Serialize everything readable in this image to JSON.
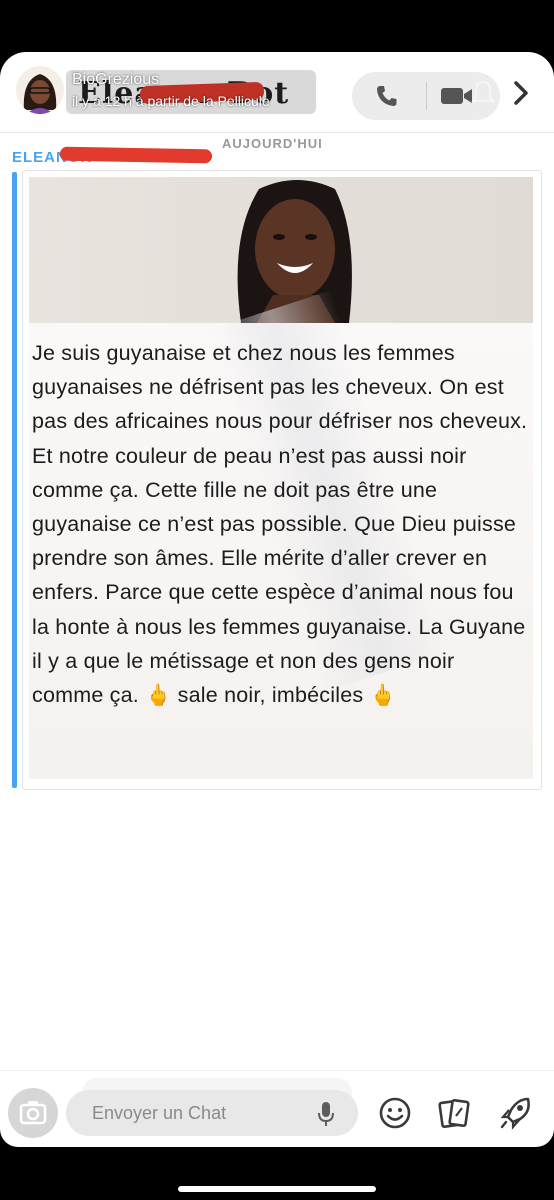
{
  "header": {
    "title": "Eleanor Bot",
    "story_name": "BioGrezious",
    "story_time": "il y a 12 h à partir de la Pellicule",
    "phone_icon": "phone-icon",
    "video_icon": "video-camera-icon",
    "chevron_icon": "chevron-right-icon"
  },
  "conversation": {
    "day_label": "AUJOURD'HUI",
    "sender": "ELEANOR",
    "accent_color": "#4aa3f0",
    "redaction_color": "#e23a2c"
  },
  "message": {
    "text": "Je suis guyanaise et chez nous les femmes guyanaises ne défrisent pas les cheveux. On est pas des africaines nous pour défriser nos cheveux. Et notre couleur de peau n’est pas aussi noir comme ça. Cette fille ne doit pas être une guyanaise ce n’est pas possible. Que Dieu puisse prendre son âmes. Elle mérite d’aller crever en enfers. Parce que cette espèce d’animal nous fou la  honte à nous les femmes guyanaise. La Guyane il y a que le métissage et non des gens noir comme ça.",
    "emoji_1": "🖕",
    "tail": " sale noir, imbéciles ",
    "emoji_2": "🖕"
  },
  "composer": {
    "placeholder": "Envoyer un Chat",
    "camera_icon": "camera-icon",
    "mic_icon": "microphone-icon",
    "emoji_icon": "smiley-icon",
    "sticker_icon": "sticker-cards-icon",
    "games_icon": "rocket-icon"
  }
}
